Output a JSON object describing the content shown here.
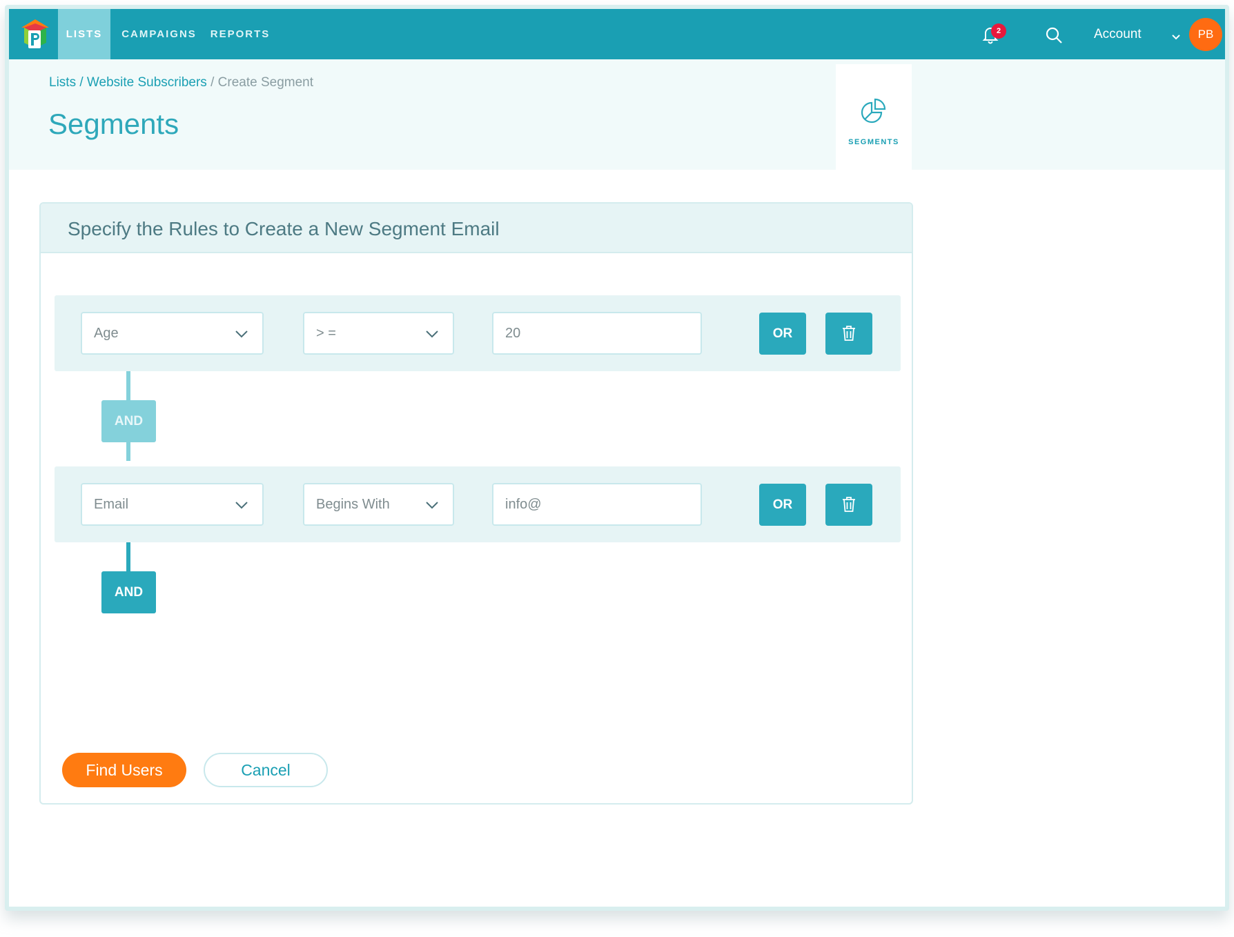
{
  "nav": {
    "tabs": [
      {
        "label": "LISTS",
        "active": true
      },
      {
        "label": "CAMPAIGNS",
        "active": false
      },
      {
        "label": "REPORTS",
        "active": false
      }
    ],
    "notification_count": "2",
    "account_label": "Account",
    "avatar_initials": "PB",
    "icons": [
      "logo-icon",
      "bell-icon",
      "search-icon",
      "chevron-down-icon"
    ]
  },
  "header": {
    "breadcrumb": {
      "lists": "Lists",
      "separator": " / ",
      "list_name": "Website Subscribers",
      "current": "/ Create Segment"
    },
    "title": "Segments",
    "side_tab_label": "SEGMENTS"
  },
  "card": {
    "title": "Specify the Rules to Create a New Segment Email"
  },
  "rules": [
    {
      "field": "Age",
      "operator": "> =",
      "value": "20",
      "or_label": "OR"
    },
    {
      "field": "Email",
      "operator": "Begins With",
      "value": "info@",
      "or_label": "OR"
    }
  ],
  "connectors": [
    {
      "label": "AND",
      "state": "inactive"
    },
    {
      "label": "AND",
      "state": "active"
    }
  ],
  "actions": {
    "find_users": "Find Users",
    "cancel": "Cancel"
  },
  "colors": {
    "brand": "#1a9fb3",
    "accent": "#ff7b11",
    "badge": "#e8193c",
    "and_inactive": "#84d1db",
    "and_active": "#2aa9bc"
  }
}
